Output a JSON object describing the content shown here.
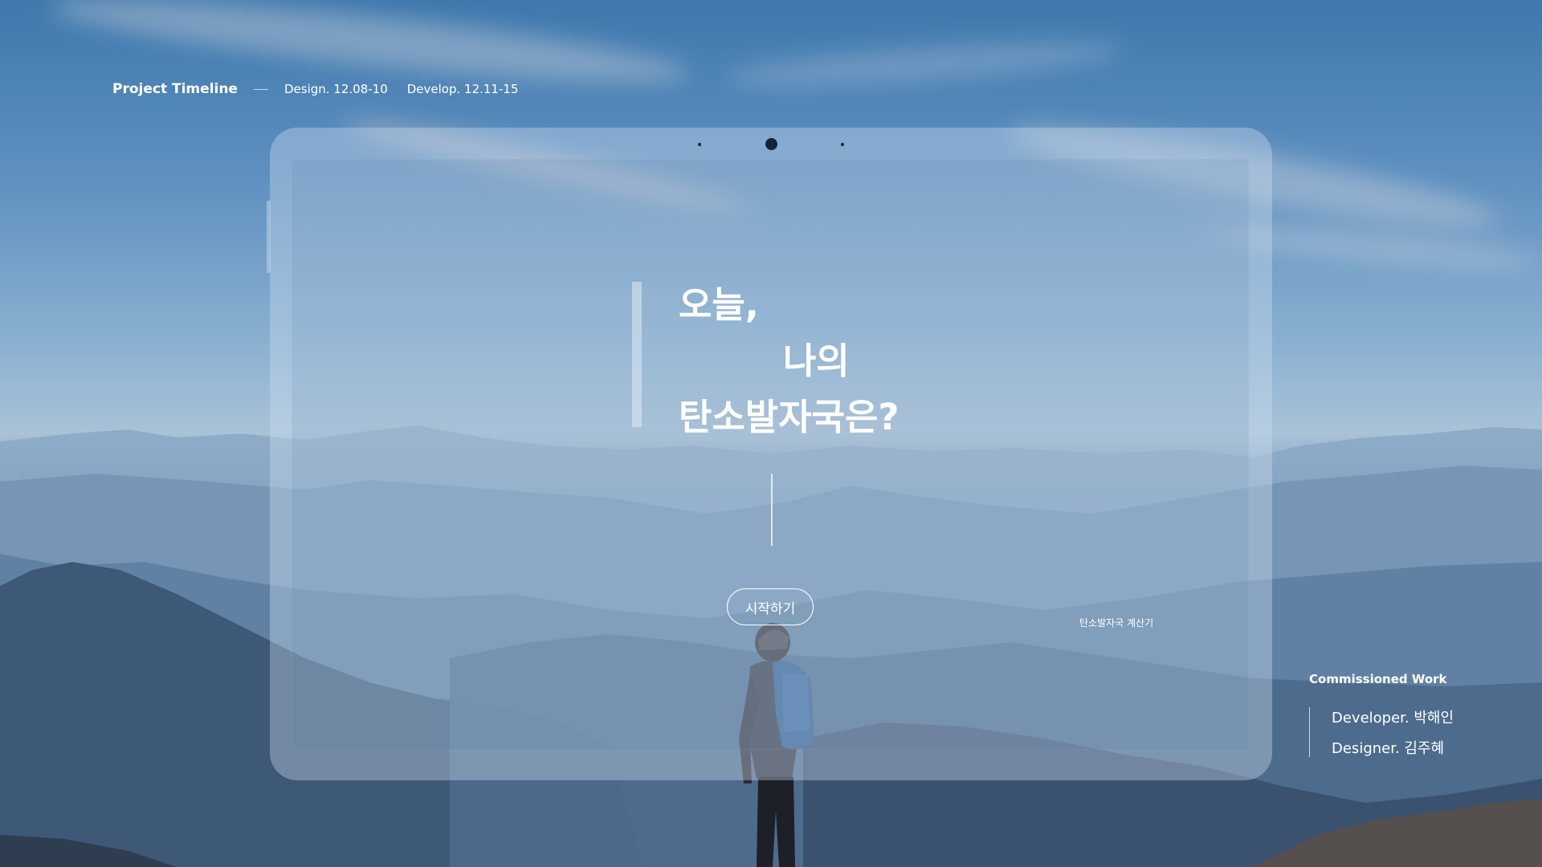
{
  "timeline": {
    "title": "Project Timeline",
    "design": "Design. 12.08-10",
    "develop": "Develop. 12.11-15"
  },
  "headline": {
    "line1": "오늘,",
    "line2": "나의",
    "line3": "탄소발자국은?"
  },
  "start_button": {
    "label": "시작하기"
  },
  "app_caption": "탄소발자국 계산기",
  "credits": {
    "title": "Commissioned Work",
    "developer": "Developer. 박해인",
    "designer": "Designer. 김주혜"
  },
  "colors": {
    "text": "#ffffff",
    "sky_top": "#3f78ad",
    "horizon": "#a9c2d7",
    "mountain_dark": "#2a3f56",
    "camera_dot": "#12243a"
  }
}
